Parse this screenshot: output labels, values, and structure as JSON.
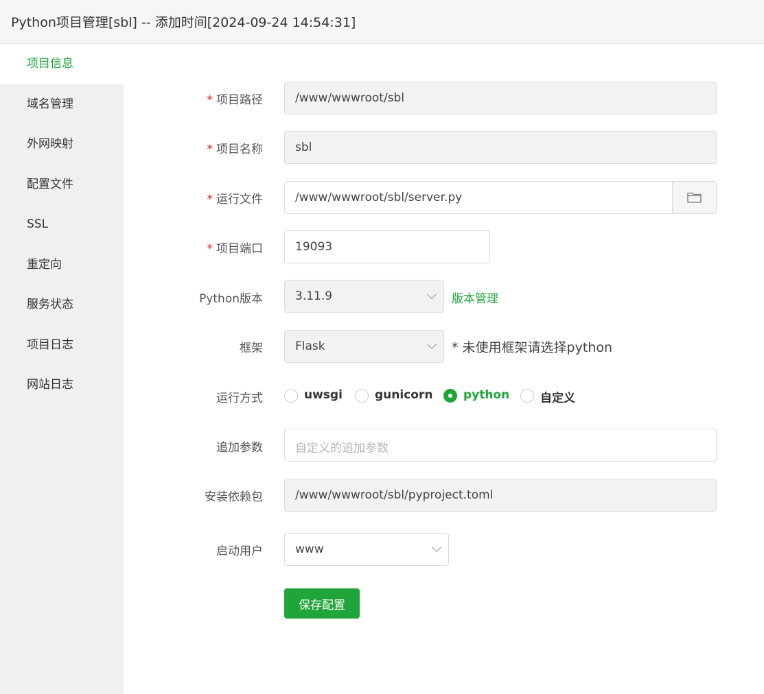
{
  "window": {
    "title": "Python项目管理[sbl] -- 添加时间[2024-09-24 14:54:31]"
  },
  "sidebar": {
    "items": [
      {
        "label": "项目信息",
        "active": true
      },
      {
        "label": "域名管理"
      },
      {
        "label": "外网映射"
      },
      {
        "label": "配置文件"
      },
      {
        "label": "SSL"
      },
      {
        "label": "重定向"
      },
      {
        "label": "服务状态"
      },
      {
        "label": "项目日志"
      },
      {
        "label": "网站日志"
      }
    ]
  },
  "form": {
    "required_mark": "*",
    "project_path": {
      "label": "项目路径",
      "value": "/www/wwwroot/sbl"
    },
    "project_name": {
      "label": "项目名称",
      "value": "sbl"
    },
    "run_file": {
      "label": "运行文件",
      "value": "/www/wwwroot/sbl/server.py",
      "icon": "folder-icon"
    },
    "project_port": {
      "label": "项目端口",
      "value": "19093"
    },
    "python_version": {
      "label": "Python版本",
      "value": "3.11.9",
      "link": "版本管理"
    },
    "framework": {
      "label": "框架",
      "value": "Flask",
      "hint": "* 未使用框架请选择python"
    },
    "run_mode": {
      "label": "运行方式",
      "options": [
        "uwsgi",
        "gunicorn",
        "python",
        "自定义"
      ],
      "selected": "python"
    },
    "extra_args": {
      "label": "追加参数",
      "placeholder": "自定义的追加参数"
    },
    "dependencies": {
      "label": "安装依赖包",
      "value": "/www/wwwroot/sbl/pyproject.toml"
    },
    "run_user": {
      "label": "启动用户",
      "value": "www"
    },
    "save_label": "保存配置"
  },
  "colors": {
    "accent": "#20a53a",
    "required": "#e02020",
    "sidebar_bg": "#f0f0f0"
  }
}
